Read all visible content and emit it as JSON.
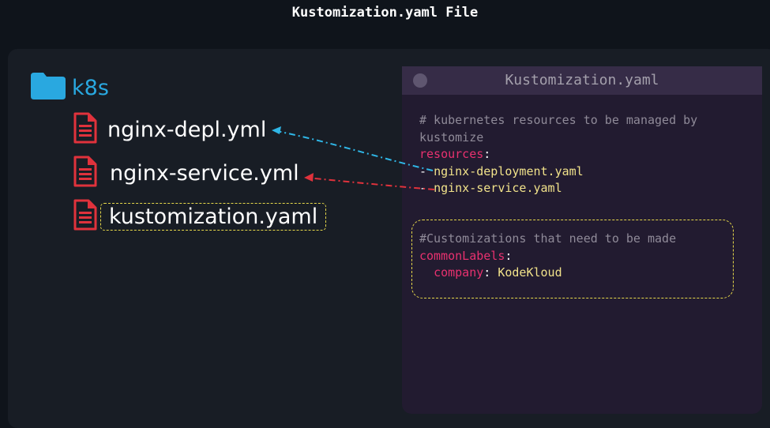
{
  "title": "Kustomization.yaml File",
  "tree": {
    "folder": {
      "label": "k8s",
      "icon": "folder-icon",
      "color": "#29a8e0"
    },
    "files": [
      {
        "label": "nginx-depl.yml",
        "icon": "file-icon"
      },
      {
        "label": "nginx-service.yml",
        "icon": "file-icon"
      },
      {
        "label": "kustomization.yaml",
        "icon": "file-icon",
        "highlighted": true
      }
    ],
    "file_icon_color": "#e0323c"
  },
  "editor": {
    "title": "Kustomization.yaml",
    "resources_comment": "# kubernetes resources to be managed by\nkustomize",
    "resources_key": "resources",
    "resource_dash": "- ",
    "resources": [
      "nginx-deployment.yaml",
      "nginx-service.yaml"
    ],
    "customizations_comment": "#Customizations that need to be made",
    "common_labels_key": "commonLabels",
    "company_key": "company",
    "company_value": "KodeKloud",
    "colon": ":"
  },
  "colors": {
    "arrow_deployment": "#2fb6e6",
    "arrow_service": "#e0323c",
    "highlight_border": "#e6d84a"
  }
}
